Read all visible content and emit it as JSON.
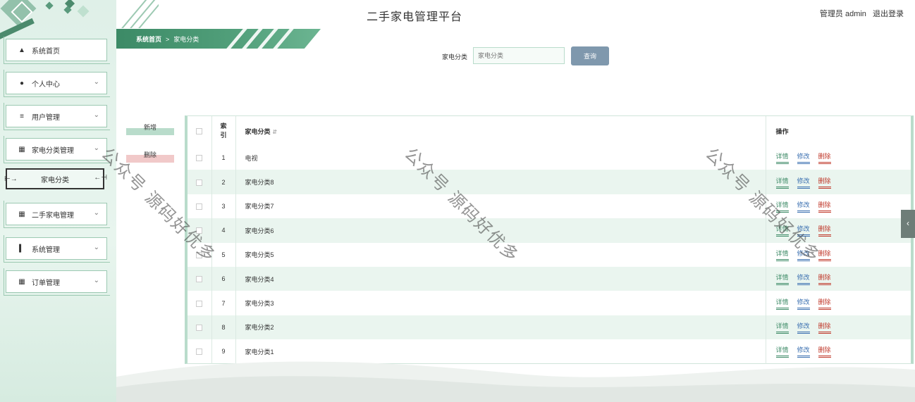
{
  "header": {
    "title": "二手家电管理平台",
    "user_label": "管理员 admin",
    "logout_label": "退出登录"
  },
  "breadcrumb": {
    "home": "系统首页",
    "separator": ">",
    "current": "家电分类"
  },
  "sidebar": {
    "items": [
      {
        "label": "系统首页",
        "icon": "home-icon",
        "has_chevron": false
      },
      {
        "label": "个人中心",
        "icon": "person-icon",
        "has_chevron": true
      },
      {
        "label": "用户管理",
        "icon": "sliders-icon",
        "has_chevron": true
      },
      {
        "label": "家电分类管理",
        "icon": "grid-icon",
        "has_chevron": true
      },
      {
        "label": "二手家电管理",
        "icon": "grid-icon",
        "has_chevron": true
      },
      {
        "label": "系统管理",
        "icon": "bar-chart-icon",
        "has_chevron": true
      },
      {
        "label": "订单管理",
        "icon": "grid-icon",
        "has_chevron": true
      }
    ],
    "subitem": {
      "label": "家电分类"
    }
  },
  "search": {
    "label": "家电分类",
    "placeholder": "家电分类",
    "button": "查询"
  },
  "actions": {
    "add": "新增",
    "delete": "删除"
  },
  "table": {
    "headers": {
      "index": "索引",
      "name": "家电分类",
      "ops": "操作"
    },
    "rows": [
      {
        "index": "1",
        "name": "电视"
      },
      {
        "index": "2",
        "name": "家电分类8"
      },
      {
        "index": "3",
        "name": "家电分类7"
      },
      {
        "index": "4",
        "name": "家电分类6"
      },
      {
        "index": "5",
        "name": "家电分类5"
      },
      {
        "index": "6",
        "name": "家电分类4"
      },
      {
        "index": "7",
        "name": "家电分类3"
      },
      {
        "index": "8",
        "name": "家电分类2"
      },
      {
        "index": "9",
        "name": "家电分类1"
      }
    ],
    "ops": {
      "detail": "详情",
      "edit": "修改",
      "remove": "删除"
    }
  },
  "watermark": "公众号 源码好优多",
  "colors": {
    "accent": "#3c8a66",
    "sidebar_bg": "#dff0e8",
    "search_button": "#7f98ad",
    "delete": "#c0392b",
    "edit": "#3a6fb0"
  }
}
